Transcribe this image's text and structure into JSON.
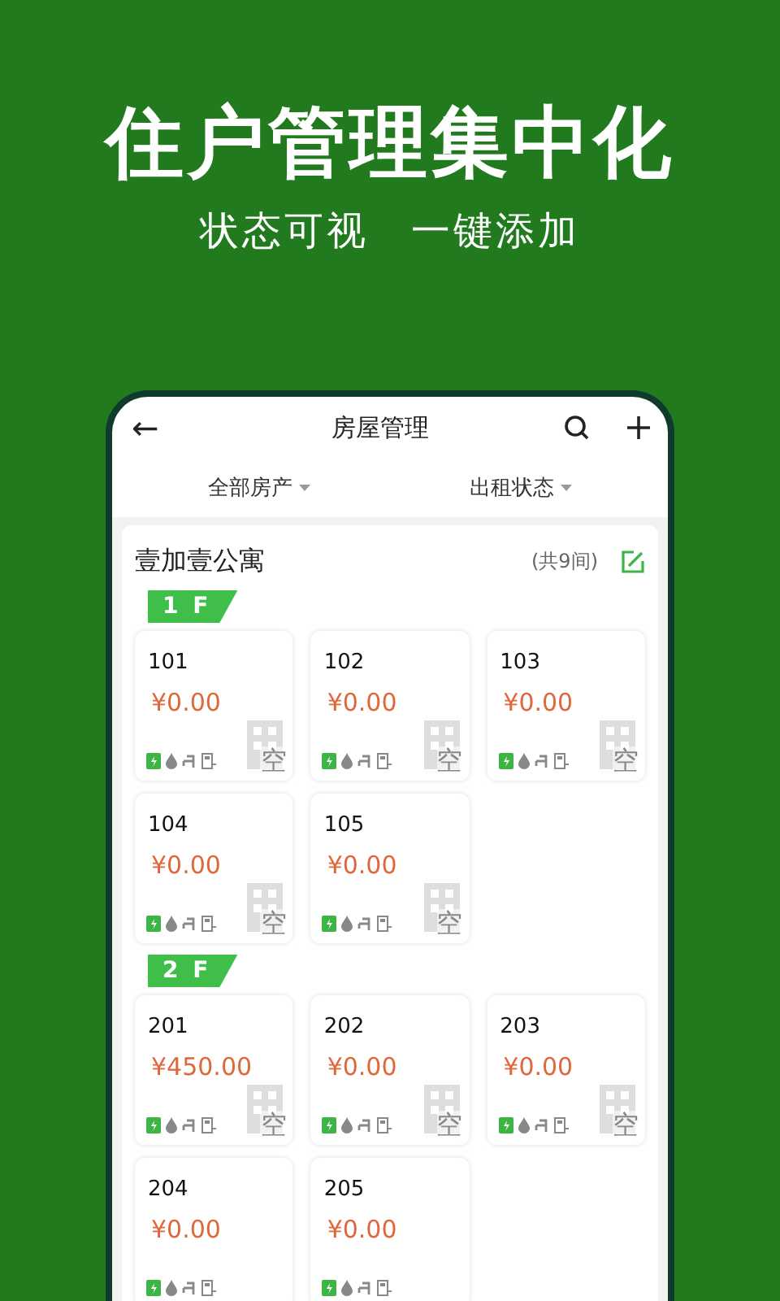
{
  "headline": "住户管理集中化",
  "subheadline": "状态可视　一键添加",
  "app_bar": {
    "back": "←",
    "title": "房屋管理"
  },
  "filters": [
    {
      "label": "全部房产"
    },
    {
      "label": "出租状态"
    }
  ],
  "property": {
    "name": "壹加壹公寓",
    "count": "(共9间)"
  },
  "floors": [
    {
      "label": "1 F",
      "rooms": [
        {
          "number": "101",
          "price": "¥0.00",
          "status": "空"
        },
        {
          "number": "102",
          "price": "¥0.00",
          "status": "空"
        },
        {
          "number": "103",
          "price": "¥0.00",
          "status": "空"
        },
        {
          "number": "104",
          "price": "¥0.00",
          "status": "空"
        },
        {
          "number": "105",
          "price": "¥0.00",
          "status": "空"
        }
      ]
    },
    {
      "label": "2 F",
      "rooms": [
        {
          "number": "201",
          "price": "¥450.00",
          "status": "空"
        },
        {
          "number": "202",
          "price": "¥0.00",
          "status": "空"
        },
        {
          "number": "203",
          "price": "¥0.00",
          "status": "空"
        },
        {
          "number": "204",
          "price": "¥0.00"
        },
        {
          "number": "205",
          "price": "¥0.00"
        }
      ]
    }
  ]
}
